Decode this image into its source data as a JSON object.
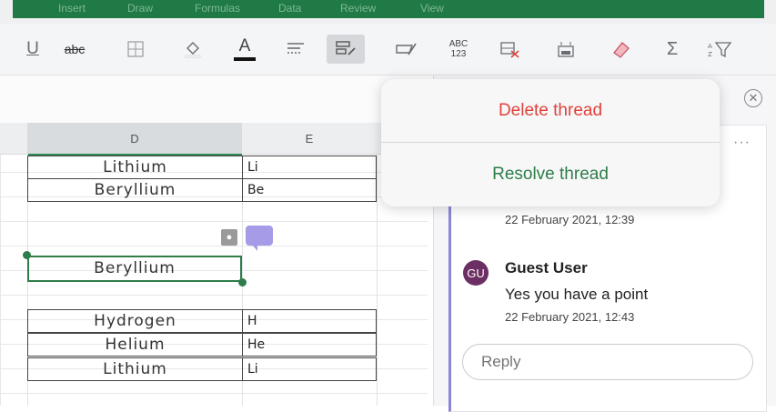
{
  "ribbon": {
    "tabs": [
      "Insert",
      "Draw",
      "Formulas",
      "Data",
      "Review",
      "View"
    ]
  },
  "toolbar": {
    "icons": [
      "underline-icon",
      "strikethrough-icon",
      "borders-icon",
      "fill-color-icon",
      "font-color-icon",
      "align-icon",
      "wrap-text-icon",
      "format-painter-icon",
      "clear-format-icon",
      "number-format-icon",
      "delete-cells-icon",
      "insert-cells-icon",
      "eraser-icon",
      "autosum-icon",
      "sort-filter-icon"
    ],
    "underline": "U",
    "strikethrough": "abc",
    "font_color_letter": "A",
    "number_format_top": "ABC",
    "number_format_bottom": "123",
    "sum": "Σ"
  },
  "columns": {
    "d": "D",
    "e": "E"
  },
  "table1": [
    {
      "name": "Lithium",
      "symbol": "Li"
    },
    {
      "name": "Beryllium",
      "symbol": "Be"
    }
  ],
  "selected_cell": {
    "value": "Beryllium"
  },
  "table2": [
    {
      "name": "Hydrogen",
      "symbol": "H"
    },
    {
      "name": "Helium",
      "symbol": "He"
    },
    {
      "name": "Lithium",
      "symbol": "Li"
    }
  ],
  "popover": {
    "delete_label": "Delete thread",
    "resolve_label": "Resolve thread",
    "delete_color": "#e0423a",
    "resolve_color": "#2e7d4a"
  },
  "thread": {
    "more": "···",
    "first_comment_time": "22 February 2021, 12:39",
    "reply_avatar_initials": "GU",
    "reply_author": "Guest User",
    "reply_text": "Yes you have a point",
    "reply_time": "22 February 2021, 12:43",
    "reply_placeholder": "Reply"
  },
  "colors": {
    "accent_green": "#1f7a45",
    "thread_accent": "#8b86d6",
    "avatar_bg": "#6c2f63"
  }
}
